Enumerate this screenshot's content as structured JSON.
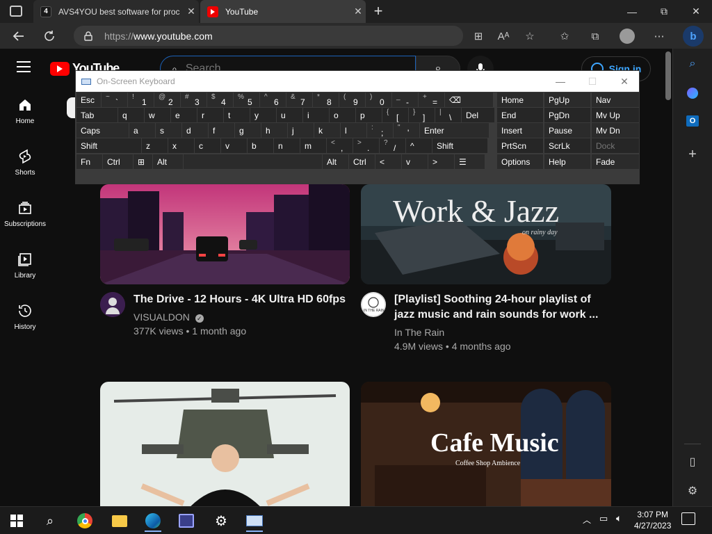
{
  "tabs": [
    {
      "badge": "4",
      "title": "AVS4YOU best software for proc",
      "close": "✕"
    },
    {
      "title": "YouTube",
      "close": "✕"
    }
  ],
  "new_tab": "+",
  "window_controls": {
    "minimize": "—",
    "maximize": "⧉",
    "close": "✕"
  },
  "address_bar": {
    "scheme": "https://",
    "host": "www.youtube.com"
  },
  "youtube": {
    "logo_text": "YouTube",
    "search_placeholder": "Search",
    "sign_in": "Sign in",
    "nav": [
      {
        "label": "Home",
        "icon": "home-icon"
      },
      {
        "label": "Shorts",
        "icon": "shorts-icon"
      },
      {
        "label": "Subscriptions",
        "icon": "subscriptions-icon"
      },
      {
        "label": "Library",
        "icon": "library-icon"
      },
      {
        "label": "History",
        "icon": "history-icon"
      }
    ],
    "videos": [
      {
        "title": "The Drive - 12 Hours - 4K Ultra HD 60fps",
        "channel": "VISUALDON",
        "verified": true,
        "meta": "377K views • 1 month ago"
      },
      {
        "title_line1": "[Playlist] Soothing 24-hour playlist of",
        "title_line2": "jazz music and rain sounds for work ...",
        "channel": "In The Rain",
        "meta": "4.9M views • 4 months ago",
        "thumb_text": "Work & Jazz",
        "thumb_sub": "on rainy day",
        "avatar_text": "IN THE RAIN"
      },
      {
        "title": ""
      },
      {
        "thumb_text": "Cafe Music",
        "thumb_sub": "Coffee Shop Ambience"
      }
    ]
  },
  "osk": {
    "title": "On-Screen Keyboard",
    "controls": {
      "minimize": "—",
      "maximize": "☐",
      "close": "✕"
    },
    "rows": [
      [
        {
          "k": "Esc"
        },
        {
          "k": "`",
          "s": "~"
        },
        {
          "k": "1",
          "s": "!"
        },
        {
          "k": "2",
          "s": "@"
        },
        {
          "k": "3",
          "s": "#"
        },
        {
          "k": "4",
          "s": "$"
        },
        {
          "k": "5",
          "s": "%"
        },
        {
          "k": "6",
          "s": "^"
        },
        {
          "k": "7",
          "s": "&"
        },
        {
          "k": "8",
          "s": "*"
        },
        {
          "k": "9",
          "s": "("
        },
        {
          "k": "0",
          "s": ")"
        },
        {
          "k": "-",
          "s": "_"
        },
        {
          "k": "=",
          "s": "+"
        },
        {
          "k": "⌫"
        }
      ],
      [
        {
          "k": "Tab"
        },
        {
          "k": "q"
        },
        {
          "k": "w"
        },
        {
          "k": "e"
        },
        {
          "k": "r"
        },
        {
          "k": "t"
        },
        {
          "k": "y"
        },
        {
          "k": "u"
        },
        {
          "k": "i"
        },
        {
          "k": "o"
        },
        {
          "k": "p"
        },
        {
          "k": "[",
          "s": "{"
        },
        {
          "k": "]",
          "s": "}"
        },
        {
          "k": "\\",
          "s": "|"
        },
        {
          "k": "Del"
        }
      ],
      [
        {
          "k": "Caps"
        },
        {
          "k": "a"
        },
        {
          "k": "s"
        },
        {
          "k": "d"
        },
        {
          "k": "f"
        },
        {
          "k": "g"
        },
        {
          "k": "h"
        },
        {
          "k": "j"
        },
        {
          "k": "k"
        },
        {
          "k": "l"
        },
        {
          "k": ";",
          "s": ":"
        },
        {
          "k": "'",
          "s": "\""
        },
        {
          "k": "Enter"
        }
      ],
      [
        {
          "k": "Shift"
        },
        {
          "k": "z"
        },
        {
          "k": "x"
        },
        {
          "k": "c"
        },
        {
          "k": "v"
        },
        {
          "k": "b"
        },
        {
          "k": "n"
        },
        {
          "k": "m"
        },
        {
          "k": ",",
          "s": "<"
        },
        {
          "k": ".",
          "s": ">"
        },
        {
          "k": "/",
          "s": "?"
        },
        {
          "k": "^"
        },
        {
          "k": "Shift"
        }
      ],
      [
        {
          "k": "Fn"
        },
        {
          "k": "Ctrl"
        },
        {
          "k": "⊞"
        },
        {
          "k": "Alt"
        },
        {
          "k": ""
        },
        {
          "k": "Alt"
        },
        {
          "k": "Ctrl"
        },
        {
          "k": "<"
        },
        {
          "k": "v"
        },
        {
          "k": ">"
        },
        {
          "k": "☰"
        }
      ]
    ],
    "nav_keys": [
      [
        "Home",
        "PgUp",
        "Nav"
      ],
      [
        "End",
        "PgDn",
        "Mv Up"
      ],
      [
        "Insert",
        "Pause",
        "Mv Dn"
      ],
      [
        "PrtScn",
        "ScrLk",
        "Dock"
      ],
      [
        "Options",
        "Help",
        "Fade"
      ]
    ]
  },
  "taskbar": {
    "apps": [
      "start-icon",
      "search-icon",
      "chrome-icon",
      "file-explorer-icon",
      "edge-icon",
      "video-editor-icon",
      "settings-icon",
      "osk-icon"
    ],
    "time": "3:07 PM",
    "date": "4/27/2023",
    "tray": [
      "chevron-up-icon",
      "network-icon",
      "volume-icon"
    ],
    "notifications_icon": "notification-icon"
  },
  "colors": {
    "yt_red": "#ff0000",
    "link_blue": "#3ea6ff",
    "edge_accent": "#0078d4"
  }
}
